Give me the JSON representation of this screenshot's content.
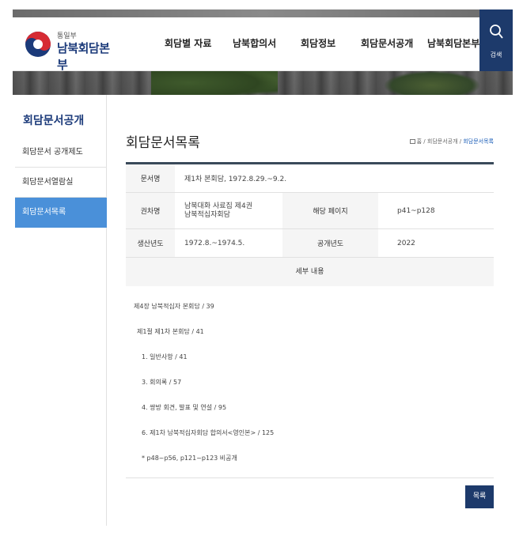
{
  "header": {
    "logo_sub": "통일부",
    "logo_main": "남북회담본부",
    "menu": [
      "회담별 자료",
      "남북합의서",
      "회담정보",
      "회담문서공개",
      "남북회담본부"
    ],
    "search_label": "검색"
  },
  "sidebar": {
    "title": "회담문서공개",
    "items": [
      {
        "label": "회담문서 공개제도",
        "active": false
      },
      {
        "label": "회담문서열람실",
        "active": false
      },
      {
        "label": "회담문서목록",
        "active": true
      }
    ]
  },
  "main": {
    "page_title": "회담문서목록",
    "breadcrumb": {
      "home": "홈",
      "sep1": "/",
      "parent": "회담문서공개",
      "sep2": "/",
      "current": "회담문서목록"
    },
    "info": {
      "doc_name_label": "문서명",
      "doc_name_value": "제1차 본회담, 1972.8.29.~9.2.",
      "volume_label": "권차명",
      "volume_value_line1": "남북대화 사료집 제4권",
      "volume_value_line2": "남북적십자회담",
      "pages_label": "해당 페이지",
      "pages_value": "p41~p128",
      "produced_label": "생산년도",
      "produced_value": "1972.8.~1974.5.",
      "disclosed_label": "공개년도",
      "disclosed_value": "2022",
      "detail_head": "세부 내용"
    },
    "details": [
      "제4장 남북적십자 본회담 / 39",
      "제1절 제1차 본회담 / 41",
      "1. 일반사항 / 41",
      "3. 회의록 / 57",
      "4. 쌍방 회견, 발표 및 연설 / 95",
      "6. 제1차 남북적십자회담 합의서<영인본> / 125",
      "* p48~p56, p121~p123 비공개"
    ],
    "list_button": "목록"
  },
  "colors": {
    "navy": "#1d3a6b",
    "active_blue": "#4a90d9",
    "title_blue": "#1b3a7a"
  }
}
